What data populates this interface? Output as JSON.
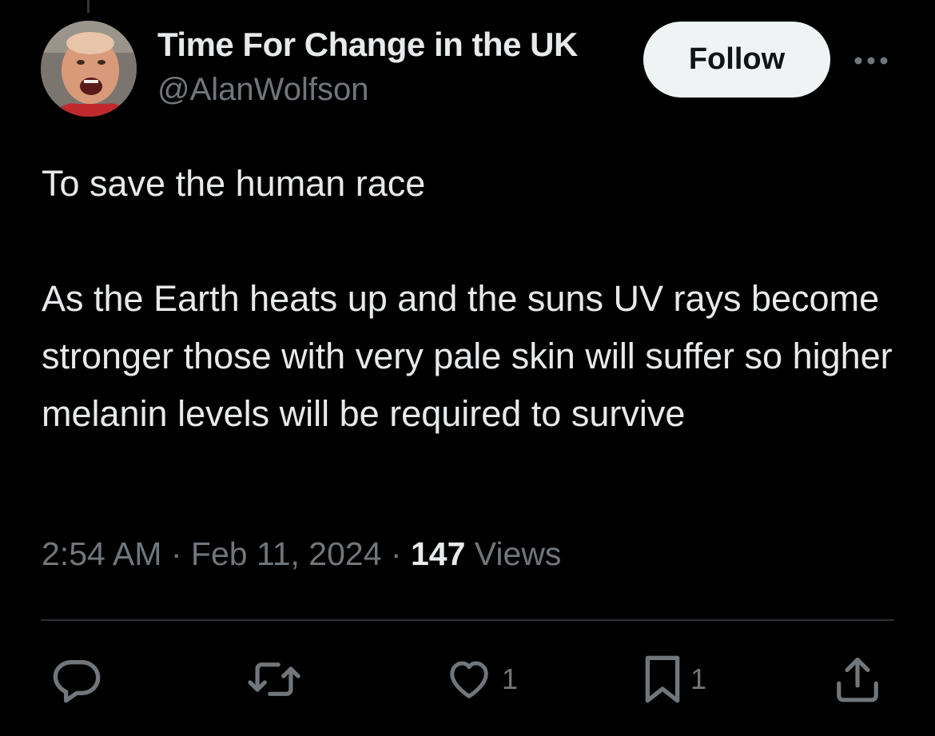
{
  "author": {
    "display_name": "Time For Change in the UK",
    "handle": "@AlanWolfson",
    "avatar_icon": "profile-photo"
  },
  "follow_button": {
    "label": "Follow"
  },
  "more_menu": {
    "icon": "more-horizontal-icon"
  },
  "tweet": {
    "text": "To save the human race\n\nAs the Earth heats up and the suns UV rays become stronger those with very pale skin will suffer so higher melanin levels will be required to survive",
    "time": "2:54 AM",
    "separator": "·",
    "date": "Feb 11, 2024",
    "views_count": "147",
    "views_label": "Views"
  },
  "actions": {
    "reply": {
      "icon": "reply-icon"
    },
    "repost": {
      "icon": "repost-icon"
    },
    "like": {
      "icon": "heart-icon",
      "count": "1"
    },
    "bookmark": {
      "icon": "bookmark-icon",
      "count": "1"
    },
    "share": {
      "icon": "share-icon"
    }
  },
  "colors": {
    "background": "#000000",
    "primary_text": "#e7e9ea",
    "secondary_text": "#71767b",
    "divider": "#2f3336",
    "follow_bg": "#eff3f4"
  }
}
